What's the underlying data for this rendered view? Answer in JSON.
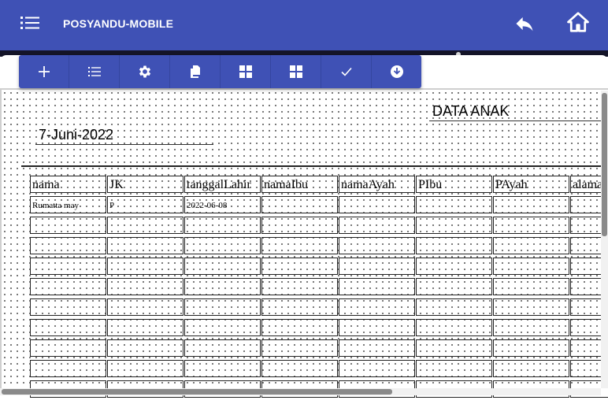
{
  "appbar": {
    "title": "POSYANDU-MOBILE",
    "icons": [
      "list-menu-icon",
      "reply-back-icon",
      "home-icon"
    ],
    "color": "#3f51b5"
  },
  "toolbar": {
    "buttons": [
      {
        "icon": "plus-icon"
      },
      {
        "icon": "list-icon"
      },
      {
        "icon": "gear-icon"
      },
      {
        "icon": "paste-icon"
      },
      {
        "icon": "grid-icon"
      },
      {
        "icon": "grid-alt-icon"
      },
      {
        "icon": "check-icon"
      },
      {
        "icon": "download-circle-icon"
      }
    ]
  },
  "document": {
    "title": "DATA ANAK",
    "date": "7-Juni-2022"
  },
  "table": {
    "columns": [
      "nama",
      "JK",
      "tanggalLahir",
      "namaIbu",
      "namaAyah",
      "PIbu",
      "PAyah",
      "alamat"
    ],
    "rows": [
      [
        "Rumatta may",
        "P",
        "2022-06-08",
        "",
        "",
        "",
        "",
        ""
      ]
    ]
  }
}
